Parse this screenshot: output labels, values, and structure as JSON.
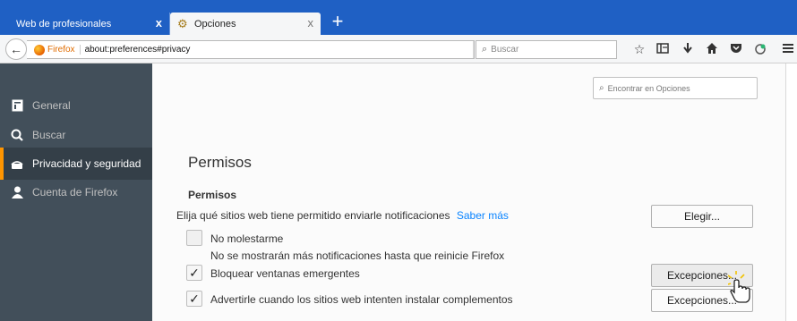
{
  "tabs": [
    {
      "label": "Web de profesionales",
      "close": "x"
    },
    {
      "label": "Opciones",
      "close": "x"
    }
  ],
  "new_tab": "+",
  "nav": {
    "back": "←",
    "url_brand": "Firefox",
    "url": "about:preferences#privacy",
    "reload": "C",
    "search_placeholder": "Buscar",
    "search_glyph": "⌕"
  },
  "toolbar_icons": [
    "star-icon",
    "bookmarks-library-icon",
    "download-icon",
    "home-icon",
    "pocket-icon",
    "extension-icon",
    "menu-icon"
  ],
  "sidebar": {
    "items": [
      {
        "label": "General",
        "icon": "general-icon"
      },
      {
        "label": "Buscar",
        "icon": "search-icon"
      },
      {
        "label": "Privacidad y seguridad",
        "icon": "lock-icon",
        "selected": true
      },
      {
        "label": "Cuenta de Firefox",
        "icon": "account-icon"
      }
    ]
  },
  "main": {
    "find_placeholder": "Encontrar en Opciones",
    "section_title": "Permisos",
    "subhead": "Permisos",
    "notifications_text": "Elija qué sitios web tiene permitido enviarle notificaciones",
    "learn_more": "Saber más",
    "choose_button": "Elegir...",
    "dnd_label": "No molestarme",
    "dnd_hint": "No se mostrarán más notificaciones hasta que reinicie Firefox",
    "popups_label": "Bloquear ventanas emergentes",
    "popups_checked": true,
    "exceptions_button_1": "Excepciones...",
    "addons_label": "Advertirle cuando los sitios web intenten instalar complementos",
    "addons_checked": true,
    "exceptions_button_2": "Excepciones..."
  },
  "colors": {
    "tabstrip": "#1f60c4",
    "sidebar": "#424f5a",
    "sidebar_selected_accent": "#ff9500",
    "link": "#0a84ff"
  }
}
